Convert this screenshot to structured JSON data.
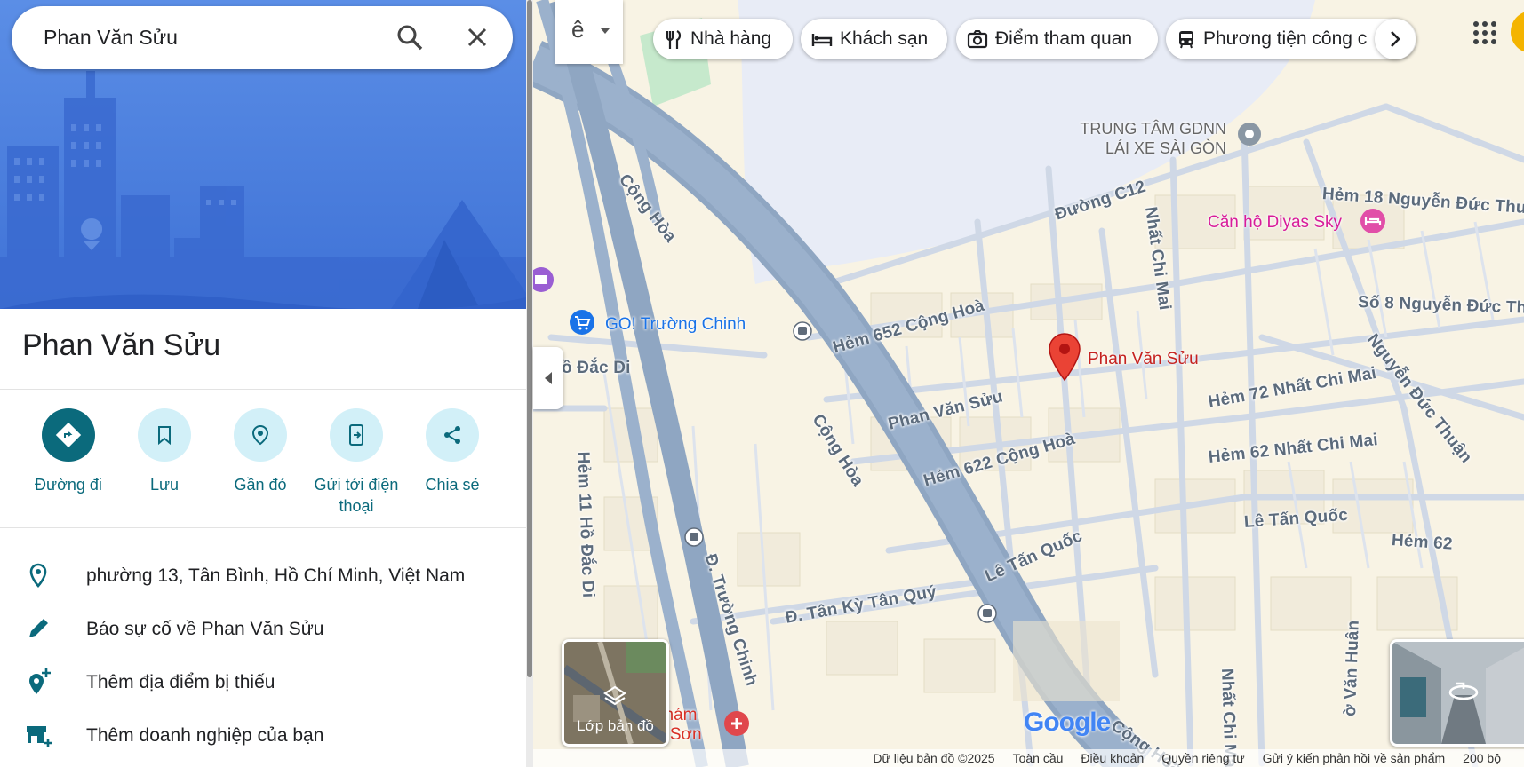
{
  "search": {
    "query": "Phan Văn Sửu"
  },
  "place": {
    "title": "Phan Văn Sửu"
  },
  "actions": [
    {
      "label": "Đường đi"
    },
    {
      "label": "Lưu"
    },
    {
      "label": "Gần đó"
    },
    {
      "label": "Gửi tới điện thoại"
    },
    {
      "label": "Chia sẻ"
    }
  ],
  "info": {
    "address": "phường 13, Tân Bình, Hồ Chí Minh, Việt Nam",
    "report": "Báo sự cố về Phan Văn Sửu",
    "add_place": "Thêm địa điểm bị thiếu",
    "add_business": "Thêm doanh nghiệp của bạn"
  },
  "chips": [
    {
      "label": "Nhà hàng",
      "icon": "fork-knife-icon"
    },
    {
      "label": "Khách sạn",
      "icon": "bed-icon"
    },
    {
      "label": "Điểm tham quan",
      "icon": "camera-icon"
    },
    {
      "label": "Phương tiện công c",
      "icon": "transit-icon"
    }
  ],
  "lang_btn": {
    "label": "ê"
  },
  "map_labels": {
    "marker_label": "Phan Văn Sửu",
    "poi_go": "GO! Trường Chinh",
    "poi_diyas": "Căn hộ Diyas Sky",
    "poi_trung_tam_1": "TRUNG TÂM GDNN",
    "poi_trung_tam_2": "LÁI XE SÀI GÒN",
    "poi_kham_1": "khám",
    "poi_kham_2": "n Sơn",
    "cong_hoa_1": "Cộng Hòa",
    "cong_hoa_2": "Cộng Hòa",
    "cong_hoa_3": "Cộng Hòa",
    "duong_c12": "Đường C12",
    "hem_652": "Hẻm 652 Cộng Hoà",
    "phan_van_suu_road": "Phan Văn Sửu",
    "hem_622": "Hẻm 622 Cộng Hoà",
    "le_tan_quoc_1": "Lê Tấn Quốc",
    "le_tan_quoc_2": "Lê Tấn Quốc",
    "tan_ky_tan_quy": "Đ. Tân Kỳ Tân Quý",
    "truong_chinh": "Đ. Trường Chinh",
    "nhat_chi_mai_1": "Nhất Chi Mai",
    "nhat_chi_mai_2": "Nhất Chi Mai",
    "hem_72": "Hẻm 72 Nhất Chi Mai",
    "hem_62_ncm": "Hẻm 62 Nhất Chi Mai",
    "hem_62": "Hẻm 62",
    "hem_18": "Hẻm 18 Nguyễn Đức Thu",
    "so_8": "Số 8 Nguyễn Đức Th",
    "nguyen_duc_thuan": "Nguyễn Đức Thuận",
    "hem_11": "Hẻm 11 Hồ Đắc Di",
    "o_dac_di": "ồ Đắc Di",
    "van_huan": "ờ Văn Huân"
  },
  "layers": {
    "label": "Lớp bản đồ"
  },
  "google_logo": "Google",
  "footer": {
    "data": "Dữ liệu bản đồ ©2025",
    "global": "Toàn cầu",
    "terms": "Điều khoản",
    "privacy": "Quyền riêng tư",
    "feedback": "Gửi ý kiến phản hồi về sản phẩm",
    "scale": "200 bộ"
  },
  "colors": {
    "accent": "#0b6a7c",
    "marker": "#ea4335",
    "diyas": "#d81b9a",
    "go_blue": "#1a73e8"
  }
}
